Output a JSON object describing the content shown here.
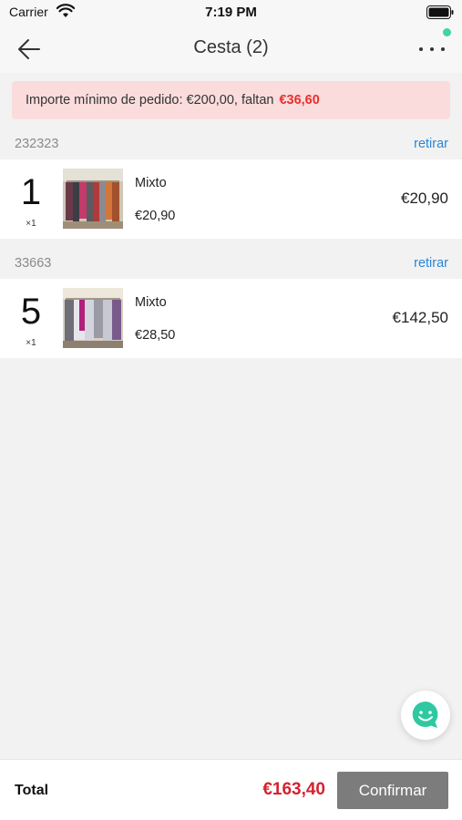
{
  "status_bar": {
    "carrier": "Carrier",
    "time": "7:19 PM"
  },
  "nav": {
    "title": "Cesta (2)",
    "back_icon": "arrow-left-icon",
    "more_icon": "more-horizontal-icon"
  },
  "banner": {
    "text": "Importe mínimo de pedido: €200,00, faltan",
    "amount": "€36,60"
  },
  "sellers": [
    {
      "id": "232323",
      "remove_label": "retirar",
      "item": {
        "qty": "1",
        "multiplier": "×1",
        "name": "Mixto",
        "unit_price": "€20,90",
        "total": "€20,90"
      }
    },
    {
      "id": "33663",
      "remove_label": "retirar",
      "item": {
        "qty": "5",
        "multiplier": "×1",
        "name": "Mixto",
        "unit_price": "€28,50",
        "total": "€142,50"
      }
    }
  ],
  "footer": {
    "total_label": "Total",
    "total_amount": "€163,40",
    "confirm_label": "Confirmar"
  },
  "colors": {
    "accent_red": "#e8302f",
    "total_red": "#d42230",
    "link_blue": "#2a86d8",
    "notif_green": "#3ed3a8",
    "chat_green": "#2ec9a0",
    "button_gray": "#7c7c7c"
  },
  "chat_icon": "chat-smile-icon"
}
